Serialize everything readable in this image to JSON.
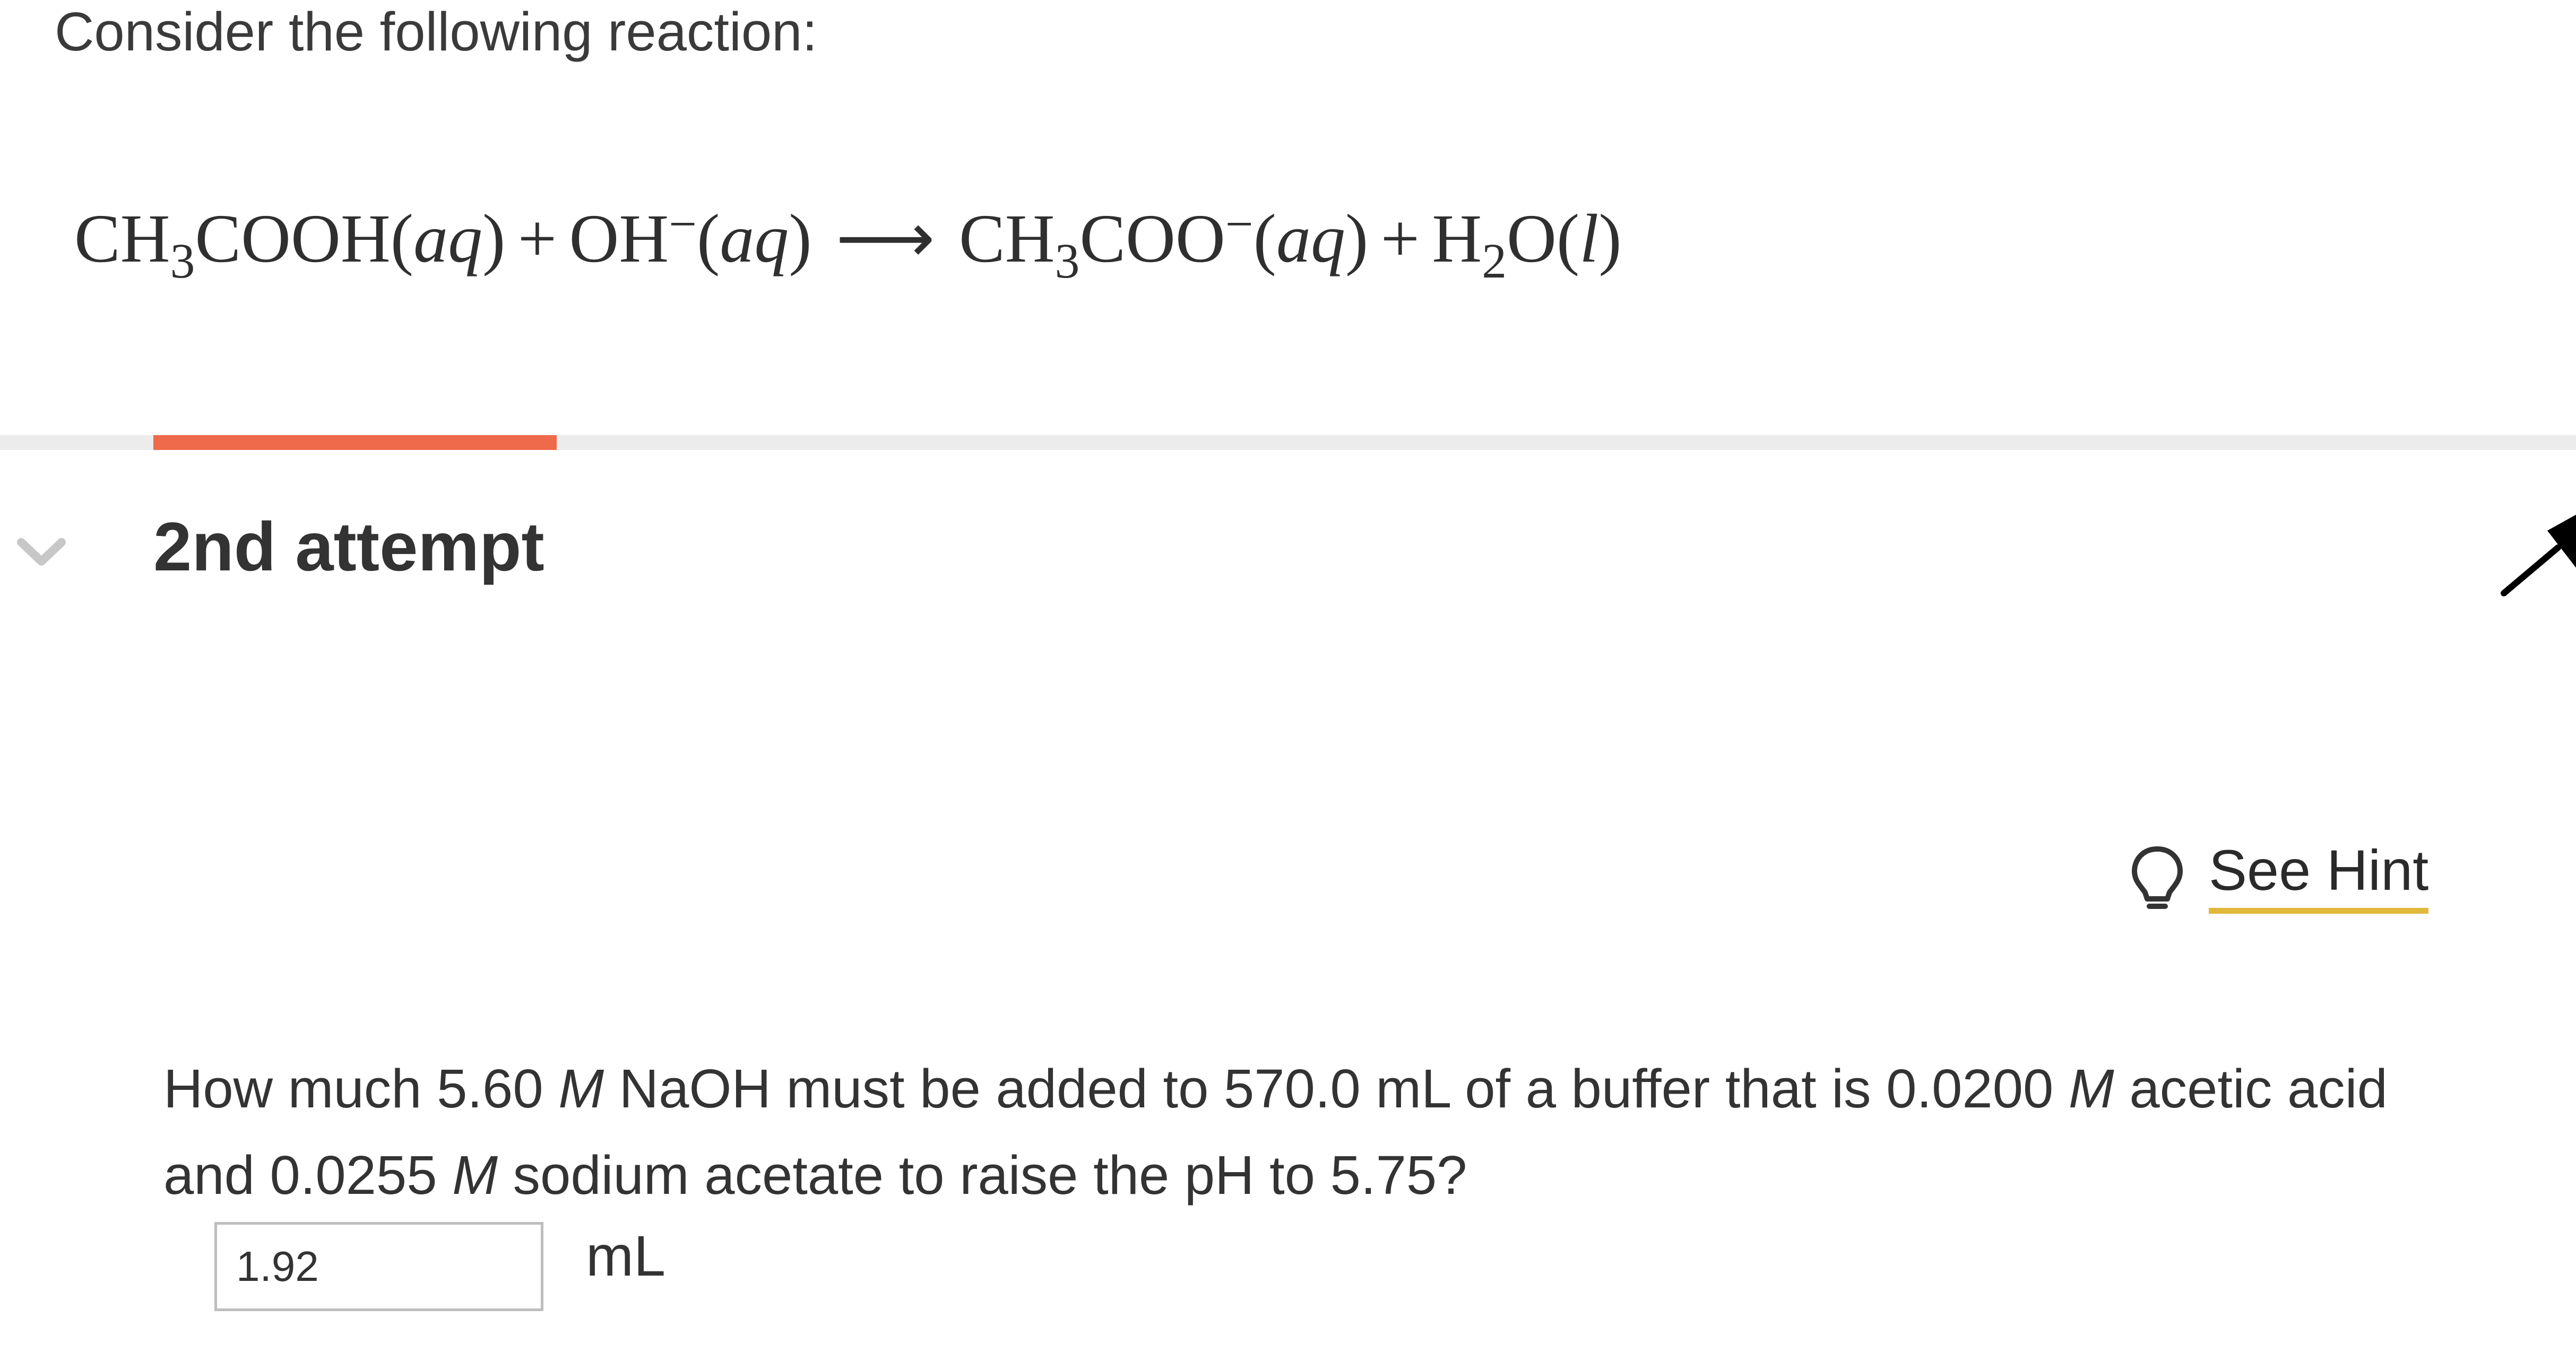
{
  "prompt": {
    "intro": "Consider the following reaction:"
  },
  "equation": {
    "r1_main": "CH",
    "r1_sub": "3",
    "r1_rest": "COOH",
    "aq": "aq",
    "plus": "+",
    "r2_main": "OH",
    "r2_sup": "−",
    "arrow": "⟶",
    "p1_main": "CH",
    "p1_sub": "3",
    "p1_rest": "COO",
    "p1_sup": "−",
    "p2_main": "H",
    "p2_sub": "2",
    "p2_rest": "O",
    "l": "l",
    "open": "(",
    "close": ")"
  },
  "progress": {
    "accent_color": "#ee6a4a",
    "track_color": "#ececec"
  },
  "attempt": {
    "title": "2nd attempt",
    "collapse_icon": "chevron-down-icon"
  },
  "hint": {
    "label": "See Hint",
    "icon": "lightbulb-icon",
    "underline_color": "#e0b83a"
  },
  "question": {
    "part1": "How much 5.60 ",
    "unit_M1": "M",
    "part2": " NaOH must be added to 570.0 mL of a buffer that is 0.0200 ",
    "unit_M2": "M",
    "part3": " acetic acid and 0.0255 ",
    "unit_M3": "M",
    "part4": " sodium acetate to raise the pH to 5.75?"
  },
  "answer": {
    "value": "1.92",
    "unit": "mL"
  },
  "cursor": {
    "icon": "mouse-pointer-icon"
  }
}
